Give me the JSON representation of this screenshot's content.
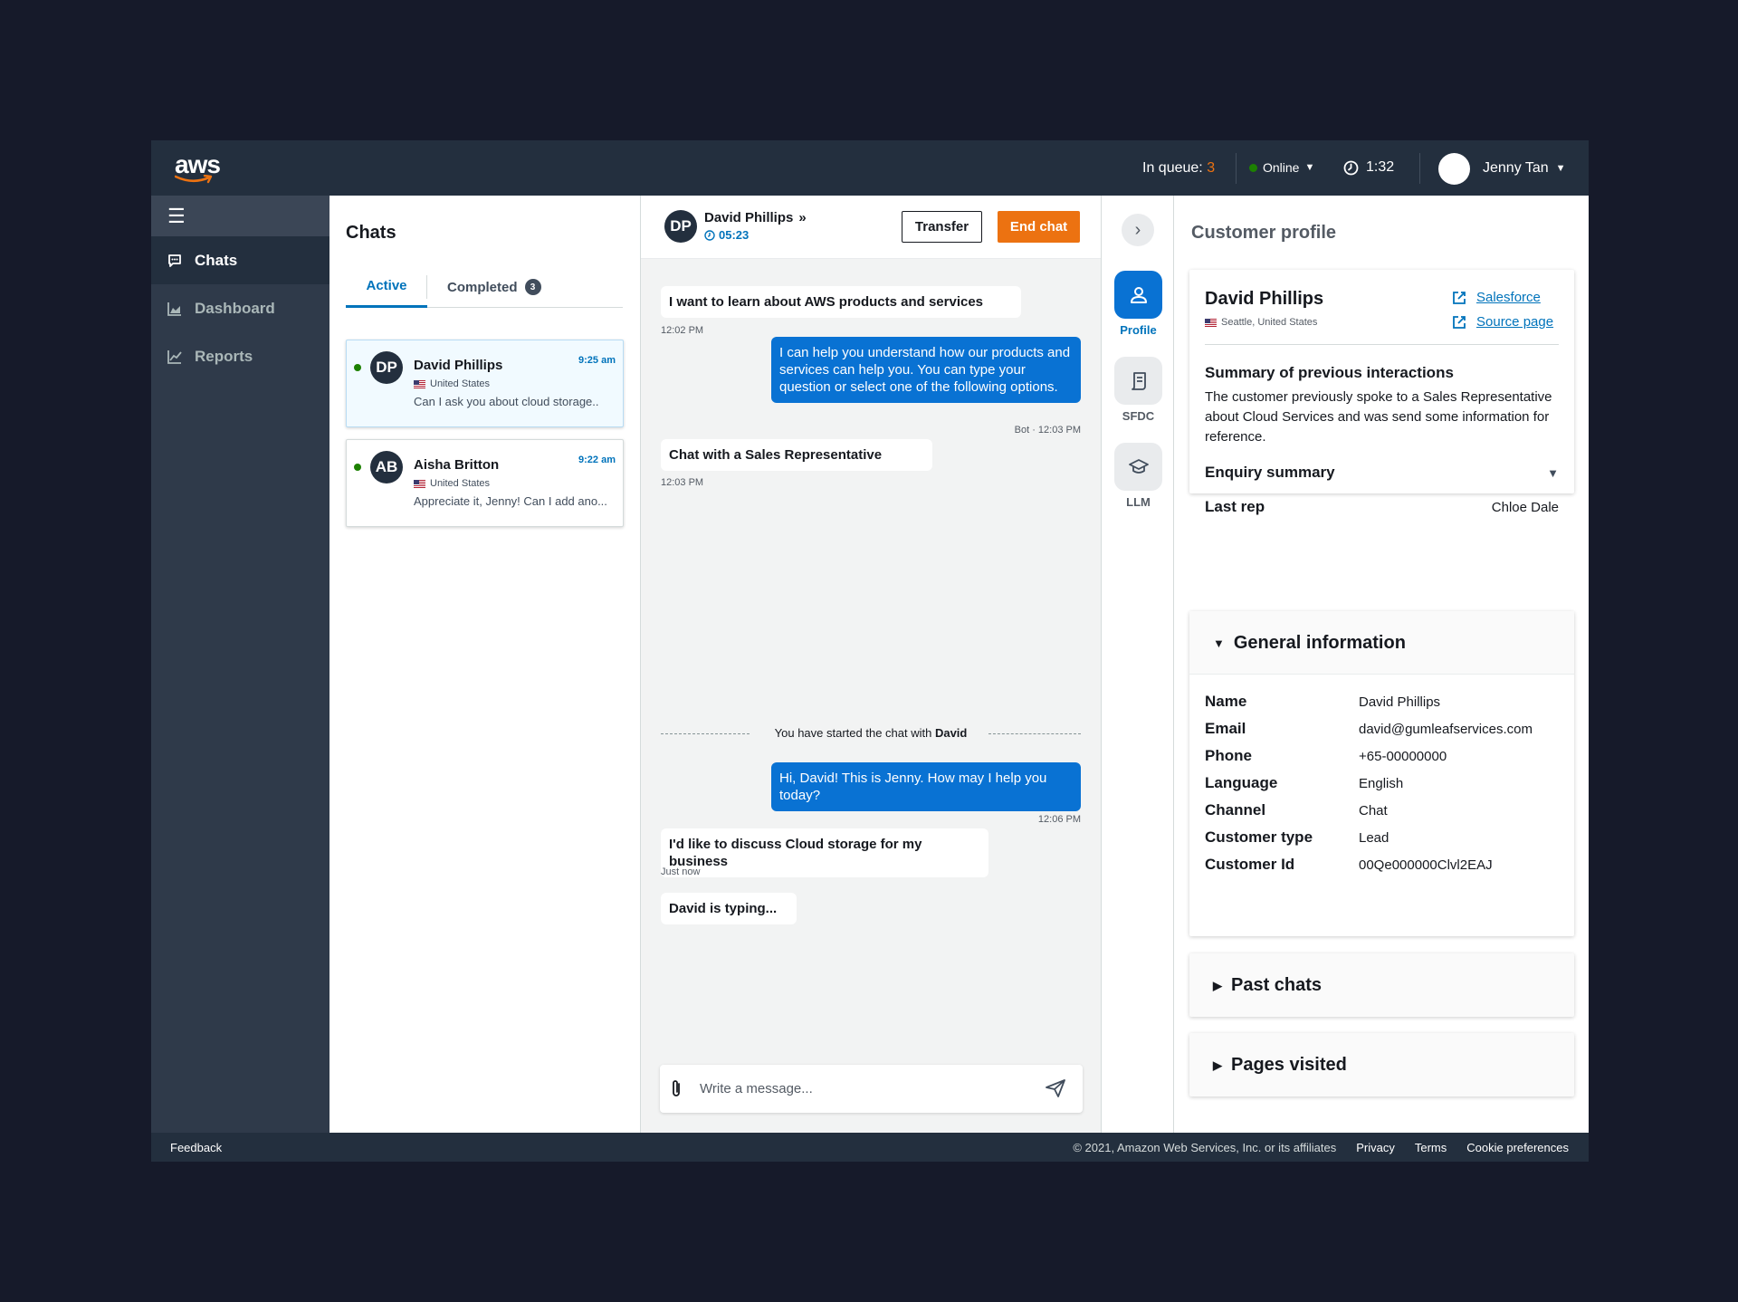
{
  "topbar": {
    "logo": "aws",
    "queue_label": "In queue:",
    "queue_count": "3",
    "status": "Online",
    "timer": "1:32",
    "user": "Jenny Tan"
  },
  "nav": {
    "items": [
      {
        "label": "Chats",
        "icon": "chat-icon",
        "active": true
      },
      {
        "label": "Dashboard",
        "icon": "area-chart-icon"
      },
      {
        "label": "Reports",
        "icon": "line-chart-icon"
      }
    ]
  },
  "chats": {
    "title": "Chats",
    "tabs": {
      "active": "Active",
      "completed": "Completed",
      "completed_count": "3"
    },
    "list": [
      {
        "initials": "DP",
        "name": "David Phillips",
        "time": "9:25 am",
        "country": "United States",
        "preview": "Can I ask you about cloud storage.."
      },
      {
        "initials": "AB",
        "name": "Aisha Britton",
        "time": "9:22 am",
        "country": "United States",
        "preview": "Appreciate it, Jenny! Can I add ano..."
      }
    ]
  },
  "conversation": {
    "initials": "DP",
    "name": "David Phillips",
    "duration": "05:23",
    "transfer_label": "Transfer",
    "end_label": "End chat",
    "messages": [
      {
        "text": "I want to learn about AWS products and services",
        "meta": "12:02 PM"
      },
      {
        "text": "I can help you understand how our products and services can help you. You can type your question or select one of the following options.",
        "meta": "Bot · 12:03 PM"
      },
      {
        "text": "Chat with a Sales Representative",
        "meta": "12:03 PM"
      },
      {
        "text": "Hi, David! This is Jenny. How may I help you today?",
        "meta": "12:06 PM"
      },
      {
        "text": "I'd like to discuss Cloud storage for my business",
        "meta": "Just now"
      },
      {
        "text": "David is typing..."
      }
    ],
    "divider_prefix": "You have started the chat with ",
    "divider_name": "David",
    "composer_placeholder": "Write a message..."
  },
  "tools": [
    {
      "label": "Profile",
      "icon": "person-icon",
      "active": true
    },
    {
      "label": "SFDC",
      "icon": "document-icon"
    },
    {
      "label": "LLM",
      "icon": "graduation-cap-icon"
    }
  ],
  "profile": {
    "title": "Customer profile",
    "name": "David Phillips",
    "location": "Seattle, United States",
    "links": [
      "Salesforce",
      "Source page"
    ],
    "summary_title": "Summary of previous interactions",
    "summary": "The customer previously spoke to a Sales Representative about Cloud Services and was send some information for reference.",
    "enquiry_title": "Enquiry summary",
    "last_rep_label": "Last rep",
    "last_rep": "Chloe Dale",
    "general_title": "General information",
    "info": [
      {
        "label": "Name",
        "value": "David Phillips"
      },
      {
        "label": "Email",
        "value": "david@gumleafservices.com"
      },
      {
        "label": "Phone",
        "value": "+65-00000000"
      },
      {
        "label": "Language",
        "value": "English"
      },
      {
        "label": "Channel",
        "value": "Chat"
      },
      {
        "label": "Customer type",
        "value": "Lead"
      },
      {
        "label": "Customer Id",
        "value": "00Qe000000Clvl2EAJ"
      }
    ],
    "past_chats": "Past chats",
    "pages_visited": "Pages visited"
  },
  "footer": {
    "feedback": "Feedback",
    "copyright": "© 2021, Amazon Web Services, Inc. or its affiliates",
    "privacy": "Privacy",
    "terms": "Terms",
    "cookies": "Cookie preferences"
  },
  "colors": {
    "nav_bg": "#232f3e",
    "accent_blue": "#0972d3",
    "accent_orange": "#ec7211",
    "online_green": "#1d8102"
  }
}
